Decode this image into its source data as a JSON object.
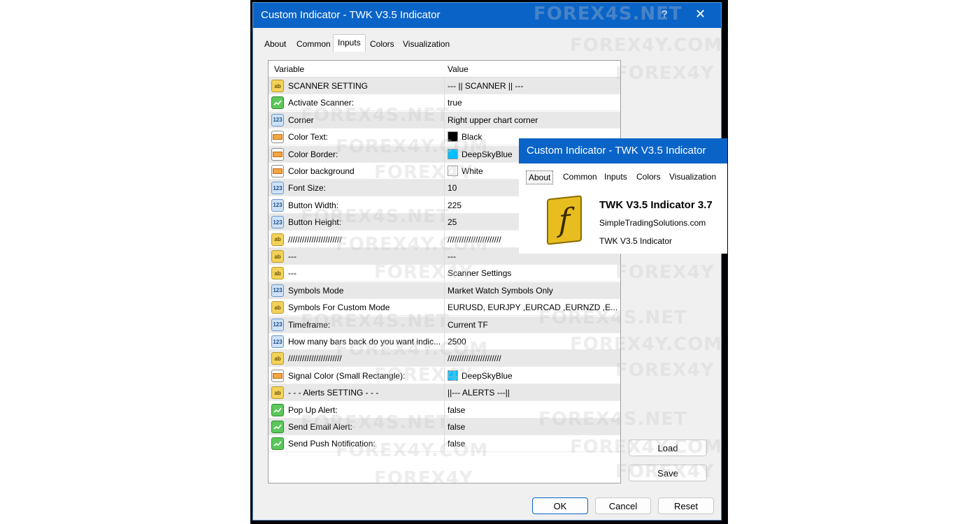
{
  "dialog": {
    "title": "Custom Indicator - TWK V3.5 Indicator",
    "help": "?",
    "close": "✕",
    "tabs": [
      "About",
      "Common",
      "Inputs",
      "Colors",
      "Visualization"
    ],
    "active_tab": "Inputs"
  },
  "grid": {
    "col_variable": "Variable",
    "col_value": "Value",
    "rows": [
      {
        "type": "ab",
        "name": "SCANNER SETTING",
        "value": "--- || SCANNER || ---"
      },
      {
        "type": "bool",
        "name": "Activate Scanner:",
        "value": "true"
      },
      {
        "type": "123",
        "name": "Corner",
        "value": "Right upper chart corner"
      },
      {
        "type": "color",
        "name": "Color Text:",
        "value": "Black",
        "swatch": "#000000"
      },
      {
        "type": "color",
        "name": "Color Border:",
        "value": "DeepSkyBlue",
        "swatch": "#00bfff"
      },
      {
        "type": "color",
        "name": "Color background",
        "value": "White",
        "swatch": "#ffffff"
      },
      {
        "type": "123",
        "name": "Font Size:",
        "value": "10"
      },
      {
        "type": "123",
        "name": "Button Width:",
        "value": "225"
      },
      {
        "type": "123",
        "name": "Button Height:",
        "value": "25"
      },
      {
        "type": "ab",
        "name": "///////////////////////",
        "value": "///////////////////////"
      },
      {
        "type": "ab",
        "name": "---",
        "value": "---"
      },
      {
        "type": "ab",
        "name": "---",
        "value": "Scanner Settings"
      },
      {
        "type": "123",
        "name": "Symbols Mode",
        "value": "Market Watch Symbols Only"
      },
      {
        "type": "ab",
        "name": "Symbols For Custom Mode",
        "value": "EURUSD, EURJPY ,EURCAD ,EURNZD ,E..."
      },
      {
        "type": "123",
        "name": "Timeframe:",
        "value": "Current TF"
      },
      {
        "type": "123",
        "name": "How many bars back do you want indic...",
        "value": "2500"
      },
      {
        "type": "ab",
        "name": "///////////////////////",
        "value": "///////////////////////"
      },
      {
        "type": "color",
        "name": "Signal Color (Small Rectangle):",
        "value": "DeepSkyBlue",
        "swatch": "#00bfff"
      },
      {
        "type": "ab",
        "name": "- - - Alerts SETTING - - -",
        "value": "||--- ALERTS ---||"
      },
      {
        "type": "bool",
        "name": "Pop Up Alert:",
        "value": "false"
      },
      {
        "type": "bool",
        "name": "Send Email Alert:",
        "value": "false"
      },
      {
        "type": "bool",
        "name": "Send Push Notification:",
        "value": "false"
      }
    ]
  },
  "buttons": {
    "load": "Load",
    "save": "Save",
    "ok": "OK",
    "cancel": "Cancel",
    "reset": "Reset"
  },
  "about_popup": {
    "title": "Custom Indicator - TWK V3.5 Indicator",
    "tabs": [
      "About",
      "Common",
      "Inputs",
      "Colors",
      "Visualization"
    ],
    "active_tab": "About",
    "logo_letter": "f",
    "product_name": "TWK V3.5 Indicator 3.7",
    "website": "SimpleTradingSolutions.com",
    "description": "TWK V3.5 Indicator"
  },
  "watermarks": [
    "FOREX4S.NET",
    "FOREX4Y.COM",
    "FOREX4Y"
  ],
  "icons": {
    "ab": "ab",
    "123": "123",
    "bool": "bool-icon",
    "color": "color-icon"
  }
}
